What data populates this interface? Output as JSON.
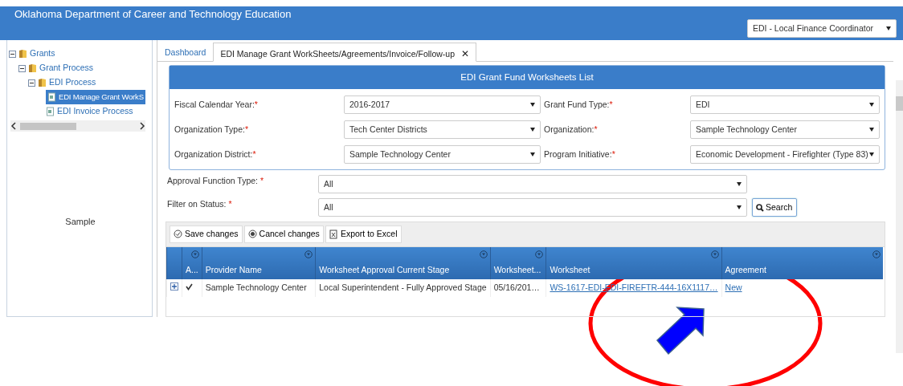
{
  "header": {
    "title": "Oklahoma Department of Career and Technology Education",
    "role_select": {
      "value": "EDI - Local Finance Coordinator"
    }
  },
  "sidebar": {
    "tree": [
      {
        "label": "Grants",
        "expanded": true,
        "selected": false,
        "children": [
          {
            "label": "Grant Process",
            "expanded": true,
            "selected": false,
            "children": [
              {
                "label": "EDI Process",
                "expanded": true,
                "selected": false,
                "children": [
                  {
                    "label": "EDI Manage Grant WorkS",
                    "selected": true
                  },
                  {
                    "label": "EDI Invoice Process",
                    "selected": false
                  }
                ]
              }
            ]
          }
        ]
      }
    ],
    "footer_text": "Sample"
  },
  "tabs": [
    {
      "label": "Dashboard",
      "selected": false
    },
    {
      "label": "EDI Manage Grant WorkSheets/Agreements/Invoice/Follow-up",
      "selected": true,
      "close_symbol": "✕"
    }
  ],
  "panel": {
    "title": "EDI Grant Fund Worksheets List",
    "fields": [
      {
        "label": "Fiscal Calendar Year:",
        "required": "*",
        "value": "2016-2017"
      },
      {
        "label": "Grant Fund Type:",
        "required": "*",
        "value": "EDI"
      },
      {
        "label": "Organization Type:",
        "required": "*",
        "value": "Tech Center Districts"
      },
      {
        "label": "Organization:",
        "required": "*",
        "value": "Sample Technology Center"
      },
      {
        "label": "Organization District:",
        "required": "*",
        "value": "Sample Technology Center"
      },
      {
        "label": "Program Initiative:",
        "required": "*",
        "value": "Economic Development - Firefighter (Type 83)"
      }
    ]
  },
  "filters": [
    {
      "label": "Approval Function Type: ",
      "required": "*",
      "value": "All"
    },
    {
      "label": "Filter on Status: ",
      "required": "*",
      "value": "All"
    }
  ],
  "search_button": "Search",
  "toolbar": [
    {
      "label": "Save changes"
    },
    {
      "label": "Cancel changes"
    },
    {
      "label": "Export to Excel"
    }
  ],
  "table": {
    "columns": [
      {
        "label": "A..."
      },
      {
        "label": "Provider Name"
      },
      {
        "label": "Worksheet Approval Current Stage"
      },
      {
        "label": "Worksheet..."
      },
      {
        "label": "Worksheet"
      },
      {
        "label": "Agreement"
      }
    ],
    "rows": [
      {
        "expanded": false,
        "cells": [
          {
            "kind": "checkbox",
            "checked": true
          },
          {
            "text": "Sample Technology Center",
            "kind": "text"
          },
          {
            "text": "Local Superintendent - Fully Approved  Stage",
            "kind": "text"
          },
          {
            "text": "05/16/201…",
            "kind": "text"
          },
          {
            "text": "WS-1617-EDI-EDI-FIREFTR-444-16X1117…",
            "kind": "link"
          },
          {
            "text": "New",
            "kind": "link"
          }
        ]
      }
    ]
  },
  "annotation": {
    "kind": "ellipse-arrow"
  }
}
